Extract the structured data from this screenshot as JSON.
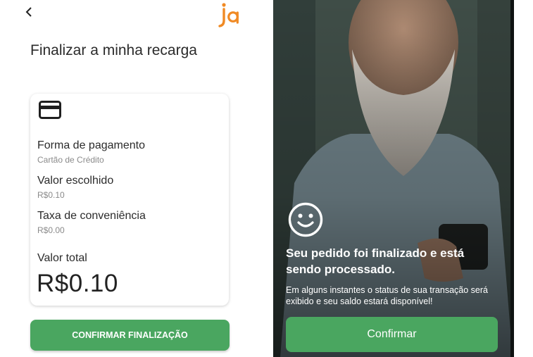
{
  "left": {
    "title": "Finalizar a minha recarga",
    "brand": "ja",
    "payment_label": "Forma de pagamento",
    "payment_value": "Cartão de Crédito",
    "amount_label": "Valor escolhido",
    "amount_value": "R$0.10",
    "fee_label": "Taxa de conveniência",
    "fee_value": "R$0.00",
    "total_label": "Valor total",
    "total_value": "R$0.10",
    "confirm_label": "CONFIRMAR FINALIZAÇÃO"
  },
  "right": {
    "title": "Seu pedido foi finalizado e está sendo processado.",
    "description": "Em alguns instantes o status de sua transação será exibido e seu saldo estará disponível!",
    "confirm_label": "Confirmar"
  },
  "colors": {
    "accent_green": "#4aa660",
    "brand_orange": "#f08a24"
  },
  "icons": [
    "back-arrow-icon",
    "credit-card-icon",
    "smiley-icon"
  ]
}
